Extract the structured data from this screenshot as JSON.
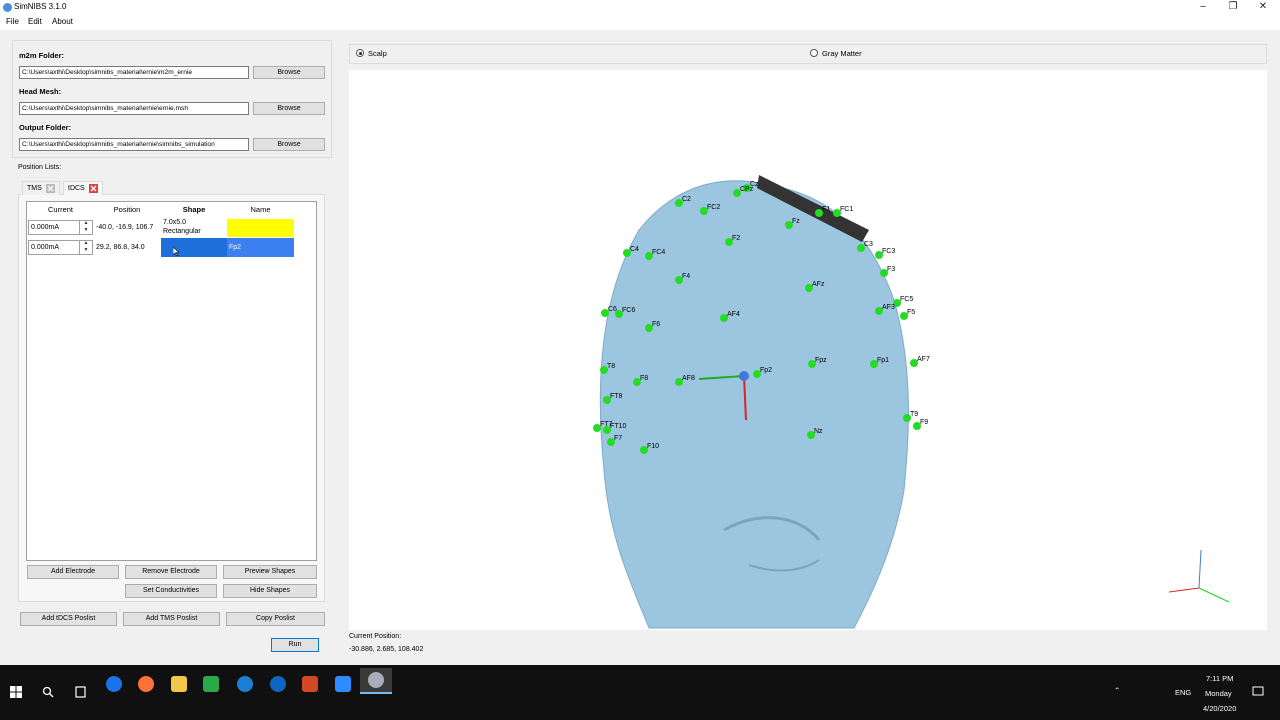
{
  "window": {
    "title": "SimNIBS 3.1.0"
  },
  "menu": [
    "File",
    "Edit",
    "About"
  ],
  "folders": {
    "m2m_label": "m2m Folder:",
    "m2m_value": "C:\\Users\\axthi\\Desktop\\simnibs_material\\ernie\\m2m_ernie",
    "head_label": "Head Mesh:",
    "head_value": "C:\\Users\\axthi\\Desktop\\simnibs_material\\ernie\\ernie.msh",
    "output_label": "Output Folder:",
    "output_value": "C:\\Users\\axthi\\Desktop\\simnibs_material\\ernie\\simnibs_simulation",
    "browse_label": "Browse"
  },
  "position_lists": {
    "label": "Position Lists:",
    "tabs": [
      "TMS",
      "tDCS"
    ]
  },
  "table": {
    "headers": [
      "Current",
      "Position",
      "Shape",
      "Name"
    ],
    "rows": [
      {
        "current": "0.000mA",
        "position": "-40.0, -16.9, 106.7",
        "shape_line1": "7.0x5.0",
        "shape_line2": "Rectangular",
        "name": ""
      },
      {
        "current": "0.000mA",
        "position": "29.2, 86.8, 34.0",
        "shape_line1": "",
        "shape_line2": "",
        "name": "Fp2"
      }
    ],
    "row_colors": [
      "#ffff00",
      "#3c7ff0"
    ]
  },
  "buttons": {
    "add_electrode": "Add Electrode",
    "remove_electrode": "Remove Electrode",
    "preview_shapes": "Preview Shapes",
    "set_conductivities": "Set Conductivities",
    "hide_shapes": "Hide Shapes",
    "add_tdcs_poslist": "Add tDCS Poslist",
    "add_tms_poslist": "Add TMS Poslist",
    "copy_poslist": "Copy Poslist",
    "run": "Run"
  },
  "view": {
    "scalp_label": "Scalp",
    "gray_label": "Gray Matter",
    "selected": "Scalp",
    "electrodes": [
      "Cz",
      "CPz",
      "C2",
      "FC2",
      "FC1",
      "Fz",
      "C3",
      "FC3",
      "F3",
      "F2",
      "FC4",
      "C4",
      "F4",
      "AFz",
      "FC5",
      "F5",
      "AF3",
      "FC6",
      "F6",
      "AF4",
      "Fpz",
      "Fp1",
      "AF7",
      "AF8",
      "F8",
      "Fp2",
      "T8",
      "FT8",
      "F7",
      "FT10",
      "F10",
      "Nz",
      "T9",
      "F9",
      "C6",
      "FT7",
      "F1"
    ],
    "current_position_label": "Current Position:",
    "current_position_value": "-30.886, 2.685, 108.402"
  },
  "taskbar": {
    "time": "7:11 PM",
    "day": "Monday",
    "date": "4/20/2020",
    "lang": "ENG"
  },
  "colors": {
    "head": "#9cc6e0",
    "electrode": "#22dd22",
    "selected_row": "#3c7ff0",
    "yellow_row": "#ffff00"
  }
}
